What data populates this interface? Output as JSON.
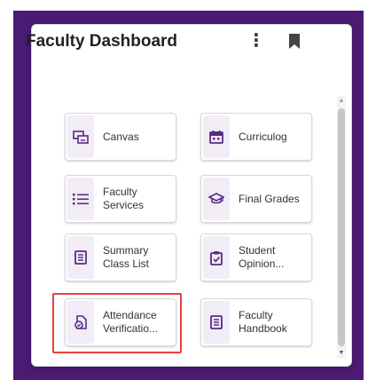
{
  "widget": {
    "title": "Faculty Dashboard",
    "menu_icon": "kebab-menu-icon",
    "menu_glyph": "⋮",
    "bookmark_icon": "bookmark-icon"
  },
  "tiles": [
    {
      "label": "Canvas",
      "icon": "canvas-icon"
    },
    {
      "label": "Curriculog",
      "icon": "calendar-icon"
    },
    {
      "label": "Faculty Services",
      "icon": "list-icon"
    },
    {
      "label": "Final Grades",
      "icon": "graduation-cap-icon"
    },
    {
      "label": "Summary Class List",
      "icon": "document-icon"
    },
    {
      "label": "Student Opinion...",
      "icon": "clipboard-check-icon"
    },
    {
      "label": "Attendance Verificatio...",
      "icon": "attendance-icon"
    },
    {
      "label": "Faculty Handbook",
      "icon": "book-icon"
    }
  ],
  "colors": {
    "frame": "#4b1a73",
    "icon_accent": "#5a2a82",
    "icon_bg": "#f1ecf6",
    "highlight": "#e8413b"
  }
}
